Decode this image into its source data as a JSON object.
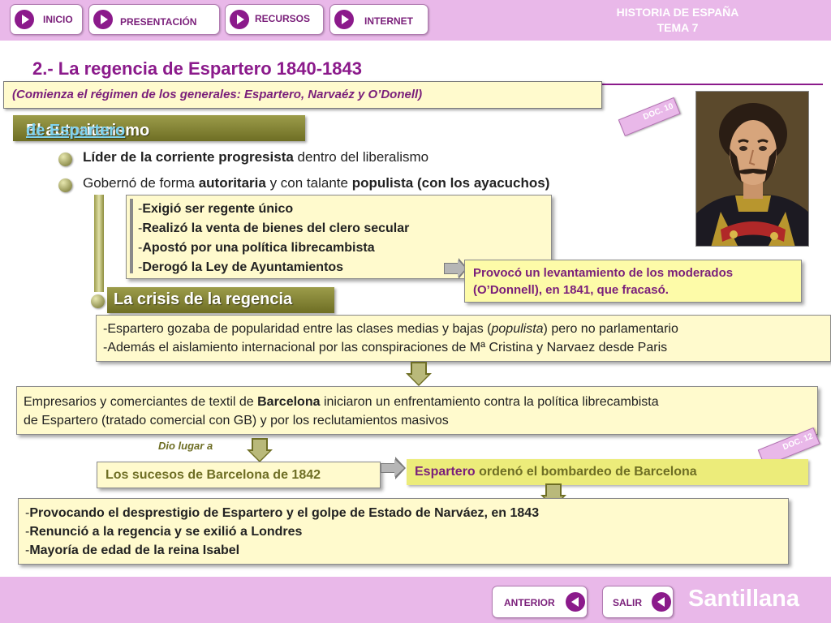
{
  "nav": {
    "inicio": "INICIO",
    "presentacion": "PRESENTACIÓN",
    "recursos": "RECURSOS",
    "internet": "INTERNET"
  },
  "header_right": {
    "line1": "HISTORIA DE ESPAÑA",
    "line2": "TEMA 7"
  },
  "title": "2.- La regencia de Espartero 1840-1843",
  "subtitle": "(Comienza el régimen de los generales: Espartero, Narvaéz y O’Donell)",
  "section1": {
    "text": "El autoritarismo ",
    "link": "de Espartero "
  },
  "doc10": "DOC. 10",
  "doc12": "DOC. 12",
  "bullets": [
    {
      "bold": "Líder de la corriente progresista",
      "rest": " dentro del liberalismo"
    },
    {
      "pre": "Gobernó de forma ",
      "b1": "autoritaria",
      "mid": " y con talante ",
      "b2": "populista (con los ayacuchos)"
    }
  ],
  "measures": [
    "Exigió ser regente único",
    "Realizó la venta de bienes del clero secular",
    "Apostó por una política librecambista",
    "Derogó la Ley de Ayuntamientos"
  ],
  "moderados": {
    "line1": "Provocó un levantamiento de los moderados",
    "line2": "(O’Donnell), en 1841, que fracasó."
  },
  "section2": "La crisis de la regencia",
  "crisis": {
    "line1_pre": "-Espartero gozaba de popularidad entre las clases medias y bajas (",
    "line1_it": "populista",
    "line1_post": ") pero no parlamentario",
    "line2": "-Además el aislamiento internacional por las conspiraciones de Mª Cristina y Narvaez desde Paris"
  },
  "barcelona": {
    "pre": "Empresarios y comerciantes de textil de ",
    "bold": "Barcelona",
    "post": " iniciaron un enfrentamiento contra la política librecambista",
    "line2": "de Espartero (tratado comercial con GB) y por los reclutamientos masivos"
  },
  "dio_lugar": "Dio lugar a",
  "sucesos": "Los sucesos de Barcelona de 1842",
  "bombardeo": {
    "name": "Espartero",
    "rest": " ordenó el bombardeo de Barcelona"
  },
  "consequences": [
    "Provocando el desprestigio de Espartero y el golpe de Estado de Narváez, en 1843",
    "Renunció a la regencia y se exilió a Londres",
    "Mayoría de edad de la reina Isabel"
  ],
  "bottom": {
    "anterior": "ANTERIOR",
    "salir": "SALIR",
    "brand": "Santillana"
  },
  "colors": {
    "purple": "#8b1a8b",
    "olive": "#6e6e24",
    "yellow_box": "#fffacd",
    "pink_bar": "#e9b8e9"
  }
}
